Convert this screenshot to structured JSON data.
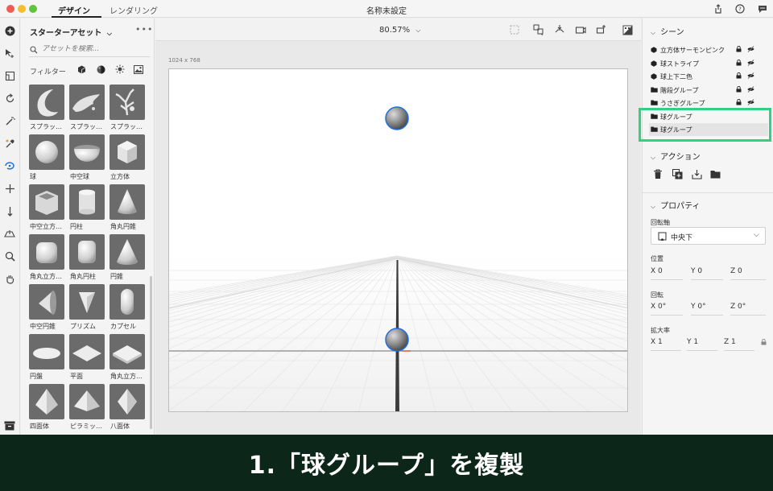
{
  "window": {
    "title": "名称未設定",
    "tabs": [
      "デザイン",
      "レンダリング"
    ]
  },
  "assets": {
    "title": "スターターアセット",
    "search_placeholder": "アセットを検索...",
    "filter_label": "フィルター",
    "items": [
      {
        "label": "スプラッ…",
        "shape": "splash-crescent"
      },
      {
        "label": "スプラッ…",
        "shape": "splash-wave"
      },
      {
        "label": "スプラッ…",
        "shape": "splash-burst"
      },
      {
        "label": "球",
        "shape": "sphere"
      },
      {
        "label": "中空球",
        "shape": "hollow-sphere"
      },
      {
        "label": "立方体",
        "shape": "cube"
      },
      {
        "label": "中空立方…",
        "shape": "hollow-cube"
      },
      {
        "label": "円柱",
        "shape": "cylinder"
      },
      {
        "label": "角丸円錐",
        "shape": "rounded-cone"
      },
      {
        "label": "角丸立方…",
        "shape": "rounded-cube"
      },
      {
        "label": "角丸円柱",
        "shape": "rounded-cylinder"
      },
      {
        "label": "円錐",
        "shape": "cone"
      },
      {
        "label": "中空円錐",
        "shape": "hollow-cone"
      },
      {
        "label": "プリズム",
        "shape": "prism"
      },
      {
        "label": "カプセル",
        "shape": "capsule"
      },
      {
        "label": "円盤",
        "shape": "disc"
      },
      {
        "label": "平面",
        "shape": "plane"
      },
      {
        "label": "角丸立方…",
        "shape": "rounded-slab"
      },
      {
        "label": "四面体",
        "shape": "tetrahedron"
      },
      {
        "label": "ピラミッ…",
        "shape": "pyramid"
      },
      {
        "label": "八面体",
        "shape": "octahedron"
      }
    ]
  },
  "stage": {
    "zoom": "80.57%",
    "canvas_size": "1024 x 768"
  },
  "scene": {
    "title": "シーン",
    "layers": [
      {
        "label": "立方体サーモンピンク",
        "type": "object"
      },
      {
        "label": "球ストライプ",
        "type": "object"
      },
      {
        "label": "球上下二色",
        "type": "object"
      },
      {
        "label": "階段グループ",
        "type": "group"
      },
      {
        "label": "うさぎグループ",
        "type": "group"
      },
      {
        "label": "球グループ",
        "type": "group"
      },
      {
        "label": "球グループ",
        "type": "group"
      }
    ]
  },
  "actions": {
    "title": "アクション"
  },
  "properties": {
    "title": "プロパティ",
    "pivot_label": "回転軸",
    "pivot_value": "中央下",
    "position_label": "位置",
    "position": {
      "x": "X  0",
      "y": "Y  0",
      "z": "Z  0"
    },
    "rotation_label": "回転",
    "rotation": {
      "x": "X  0°",
      "y": "Y  0°",
      "z": "Z  0°"
    },
    "scale_label": "拡大率",
    "scale": {
      "x": "X  1",
      "y": "Y  1",
      "z": "Z  1"
    }
  },
  "caption": "1.「球グループ」を複製",
  "colors": {
    "highlight": "#2fd27f",
    "caption_bg": "#0c2619",
    "selection": "#1f6fe0"
  }
}
